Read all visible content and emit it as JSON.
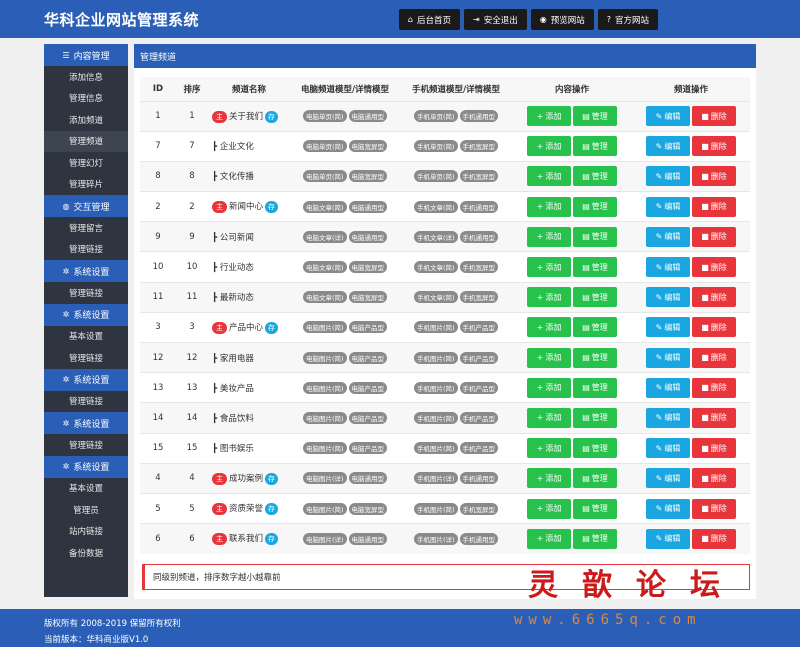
{
  "header": {
    "title": "华科企业网站管理系统",
    "nav": [
      {
        "icon": "home-icon",
        "glyph": "⌂",
        "label": "后台首页"
      },
      {
        "icon": "logout-icon",
        "glyph": "⇥",
        "label": "安全退出"
      },
      {
        "icon": "eye-icon",
        "glyph": "◉",
        "label": "预览网站"
      },
      {
        "icon": "help-icon",
        "glyph": "?",
        "label": "官方网站"
      }
    ]
  },
  "sidebar": {
    "head1": "内容管理",
    "group1": [
      "添加信息",
      "管理信息",
      "添加频道",
      "管理频道",
      "管理幻灯",
      "管理碎片"
    ],
    "head2": "交互管理",
    "group2": [
      "管理留言",
      "管理链接"
    ],
    "head3": "系统设置",
    "group3": [
      "管理链接"
    ],
    "head4": "系统设置",
    "group4": [
      "基本设置",
      "管理链接"
    ],
    "head5": "系统设置",
    "group5": [
      "管理链接"
    ],
    "head6": "系统设置",
    "group6": [
      "管理链接"
    ],
    "head7": "系统设置",
    "group7": [
      "基本设置",
      "管理员",
      "站内链接",
      "备份数据"
    ]
  },
  "panel": {
    "title": "管理频道"
  },
  "table": {
    "headers": [
      "ID",
      "排序",
      "频道名称",
      "电脑频道模型/详情模型",
      "手机频道模型/详情模型",
      "内容操作",
      "频道操作"
    ],
    "rows": [
      {
        "id": "1",
        "sort": "1",
        "main": true,
        "name": "关于我们",
        "pc": [
          "电脑单页(简)",
          "电脑通用型"
        ],
        "mobile": [
          "手机单页(简)",
          "手机通用型"
        ]
      },
      {
        "id": "7",
        "sort": "7",
        "main": false,
        "name": "┣ 企业文化",
        "pc": [
          "电脑单页(简)",
          "电脑宽屏型"
        ],
        "mobile": [
          "手机单页(简)",
          "手机宽屏型"
        ]
      },
      {
        "id": "8",
        "sort": "8",
        "main": false,
        "name": "┣ 文化传播",
        "pc": [
          "电脑单页(简)",
          "电脑宽屏型"
        ],
        "mobile": [
          "手机单页(简)",
          "手机宽屏型"
        ]
      },
      {
        "id": "2",
        "sort": "2",
        "main": true,
        "name": "新闻中心",
        "pc": [
          "电脑文章(简)",
          "电脑通用型"
        ],
        "mobile": [
          "手机文章(简)",
          "手机通用型"
        ]
      },
      {
        "id": "9",
        "sort": "9",
        "main": false,
        "name": "┣ 公司新闻",
        "pc": [
          "电脑文章(详)",
          "电脑通用型"
        ],
        "mobile": [
          "手机文章(详)",
          "手机通用型"
        ]
      },
      {
        "id": "10",
        "sort": "10",
        "main": false,
        "name": "┣ 行业动态",
        "pc": [
          "电脑文章(简)",
          "电脑宽屏型"
        ],
        "mobile": [
          "手机文章(简)",
          "手机宽屏型"
        ]
      },
      {
        "id": "11",
        "sort": "11",
        "main": false,
        "name": "┣ 最新动态",
        "pc": [
          "电脑文章(简)",
          "电脑宽屏型"
        ],
        "mobile": [
          "手机文章(简)",
          "手机宽屏型"
        ]
      },
      {
        "id": "3",
        "sort": "3",
        "main": true,
        "name": "产品中心",
        "pc": [
          "电脑图片(简)",
          "电脑产品型"
        ],
        "mobile": [
          "手机图片(简)",
          "手机产品型"
        ]
      },
      {
        "id": "12",
        "sort": "12",
        "main": false,
        "name": "┣ 家用电器",
        "pc": [
          "电脑图片(简)",
          "电脑产品型"
        ],
        "mobile": [
          "手机图片(简)",
          "手机产品型"
        ]
      },
      {
        "id": "13",
        "sort": "13",
        "main": false,
        "name": "┣ 美妆产品",
        "pc": [
          "电脑图片(简)",
          "电脑产品型"
        ],
        "mobile": [
          "手机图片(简)",
          "手机产品型"
        ]
      },
      {
        "id": "14",
        "sort": "14",
        "main": false,
        "name": "┣ 食品饮料",
        "pc": [
          "电脑图片(简)",
          "电脑产品型"
        ],
        "mobile": [
          "手机图片(简)",
          "手机产品型"
        ]
      },
      {
        "id": "15",
        "sort": "15",
        "main": false,
        "name": "┣ 图书娱乐",
        "pc": [
          "电脑图片(简)",
          "电脑产品型"
        ],
        "mobile": [
          "手机图片(简)",
          "手机产品型"
        ]
      },
      {
        "id": "4",
        "sort": "4",
        "main": true,
        "name": "成功案例",
        "pc": [
          "电脑图片(详)",
          "电脑通用型"
        ],
        "mobile": [
          "手机图片(详)",
          "手机通用型"
        ]
      },
      {
        "id": "5",
        "sort": "5",
        "main": true,
        "name": "资质荣誉",
        "pc": [
          "电脑图片(简)",
          "电脑宽屏型"
        ],
        "mobile": [
          "手机图片(简)",
          "手机宽屏型"
        ]
      },
      {
        "id": "6",
        "sort": "6",
        "main": true,
        "name": "联系我们",
        "pc": [
          "电脑图片(详)",
          "电脑通用型"
        ],
        "mobile": [
          "手机图片(详)",
          "手机通用型"
        ]
      }
    ],
    "tag_main": "主",
    "tag_save": "存",
    "btn_add": "添加",
    "btn_manage": "管理",
    "btn_edit": "编辑",
    "btn_delete": "删除"
  },
  "note": "同级别频道，排序数字越小越靠前",
  "footer": {
    "copyright": "版权所有 2008-2019 保留所有权利",
    "version": "当前版本：华科商业版V1.0"
  },
  "watermark": {
    "text": "灵歆论坛",
    "url": "www.6665q.com"
  },
  "colors": {
    "primary": "#2b5fb7",
    "sidebar": "#2f3540",
    "green": "#27c24c",
    "blue": "#1aa6e0",
    "red": "#e8353b"
  }
}
